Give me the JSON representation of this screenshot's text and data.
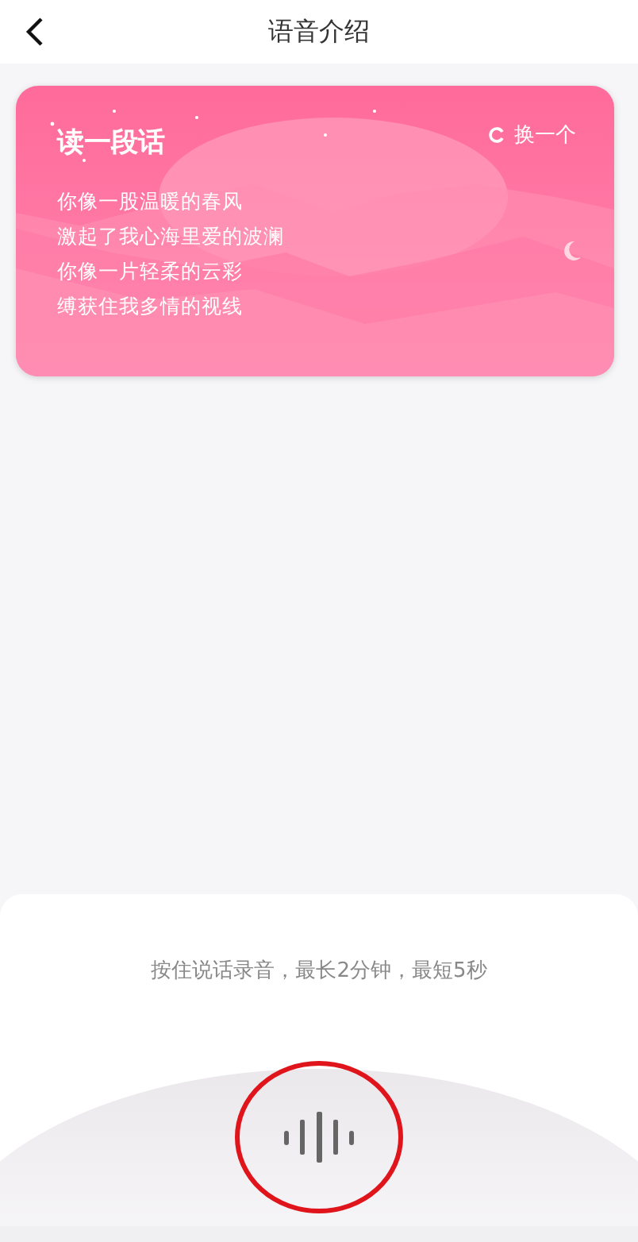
{
  "header": {
    "title": "语音介绍"
  },
  "card": {
    "title": "读一段话",
    "refresh_label": "换一个",
    "lines": [
      "你像一股温暖的春风",
      "激起了我心海里爱的波澜",
      "你像一片轻柔的云彩",
      "缚获住我多情的视线"
    ]
  },
  "recorder": {
    "hint": "按住说话录音，最长2分钟，最短5秒",
    "highlighted": true
  }
}
